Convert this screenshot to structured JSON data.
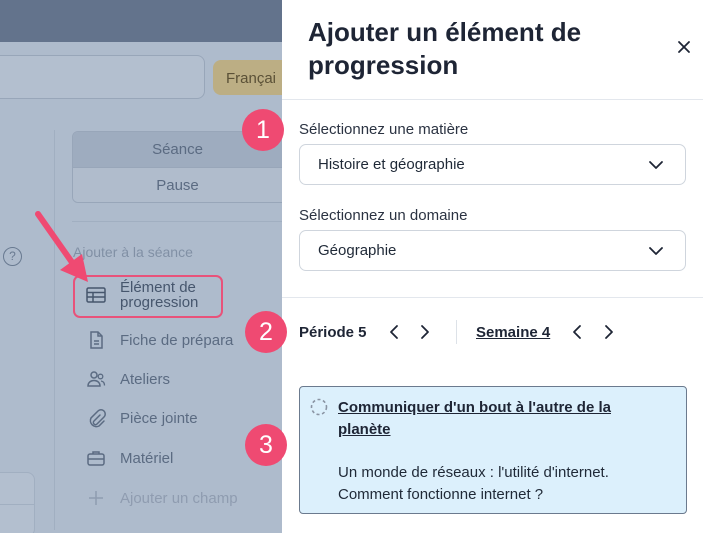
{
  "background": {
    "language_button": "Françai",
    "tabs": [
      {
        "label": "Séance",
        "active": true
      },
      {
        "label": "Pause",
        "active": false
      }
    ],
    "help_icon": "?",
    "section_title": "Ajouter à la séance",
    "items": [
      {
        "label": "Élément de progression",
        "icon": "table-icon",
        "highlighted": true
      },
      {
        "label": "Fiche de prépara",
        "icon": "document-icon"
      },
      {
        "label": "Ateliers",
        "icon": "users-icon"
      },
      {
        "label": "Pièce jointe",
        "icon": "paperclip-icon"
      },
      {
        "label": "Matériel",
        "icon": "briefcase-icon"
      },
      {
        "label": "Ajouter un champ",
        "icon": "plus-icon"
      }
    ]
  },
  "panel": {
    "title": "Ajouter un élément de progression",
    "subject": {
      "label": "Sélectionnez une matière",
      "value": "Histoire et géographie"
    },
    "domain": {
      "label": "Sélectionnez un domaine",
      "value": "Géographie"
    },
    "period": {
      "label": "Période 5",
      "week_label": "Semaine 4"
    },
    "progression_item": {
      "title": "Communiquer d'un bout à l'autre de la planète",
      "description": "Un monde de réseaux : l'utilité d'internet. Comment fonctionne internet ?"
    }
  },
  "annotations": {
    "badges": [
      "1",
      "2",
      "3"
    ],
    "accent_color": "#ef4a72"
  }
}
